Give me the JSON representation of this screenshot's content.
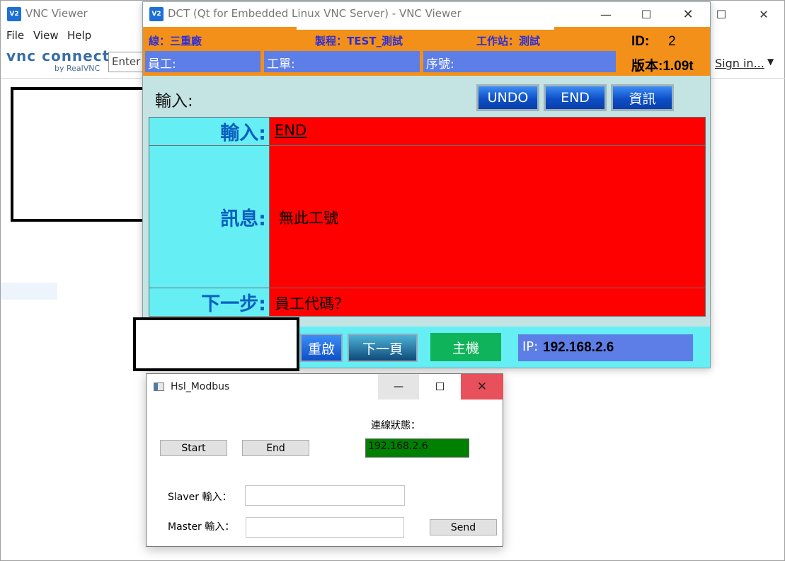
{
  "bg_window": {
    "title": "VNC Viewer",
    "logo_badge": "V2",
    "menu": [
      "File",
      "View",
      "Help"
    ],
    "brand": "vnc connect",
    "brand_sub": "by RealVNC",
    "address_placeholder": "Enter a",
    "sign_in": "Sign in...",
    "controls": {
      "minimize": "—",
      "maximize": "☐",
      "close": "✕"
    }
  },
  "dct": {
    "title": "DCT (Qt for Embedded Linux VNC Server) - VNC Viewer",
    "logo_badge": "V2",
    "header": {
      "line": "線：三重廠",
      "process": "製程：TEST_測試",
      "station": "工作站：測試",
      "id_label": "ID:",
      "id_value": "2",
      "version": "版本:1.09t",
      "employee": "員工:",
      "work_order": "工單:",
      "serial": "序號:"
    },
    "input_label": "輸入:",
    "buttons": {
      "undo": "UNDO",
      "end": "END",
      "info": "資訊"
    },
    "grid": [
      {
        "label": "輸入:",
        "value": "END"
      },
      {
        "label": "訊息:",
        "value": "無此工號"
      },
      {
        "label": "下一步:",
        "value": "員工代碼？"
      }
    ],
    "bottom": {
      "restart": "重啟",
      "next_page": "下一頁",
      "host": "主機",
      "ip_label": "IP:",
      "ip_value": "192.168.2.6"
    }
  },
  "modbus": {
    "title": "Hsl_Modbus",
    "start": "Start",
    "end": "End",
    "status_label": "連線狀態：",
    "status_value": "192.168.2.6",
    "slaver_label": "Slaver 輸入：",
    "master_label": "Master 輸入：",
    "send": "Send",
    "slaver_value": "",
    "master_value": ""
  },
  "colors": {
    "orange": "#f39019",
    "cyan": "#66eef5",
    "red": "#ff0000",
    "blue_field": "#5c7ee6",
    "host_green": "#0fb35a",
    "status_green": "#008000"
  }
}
